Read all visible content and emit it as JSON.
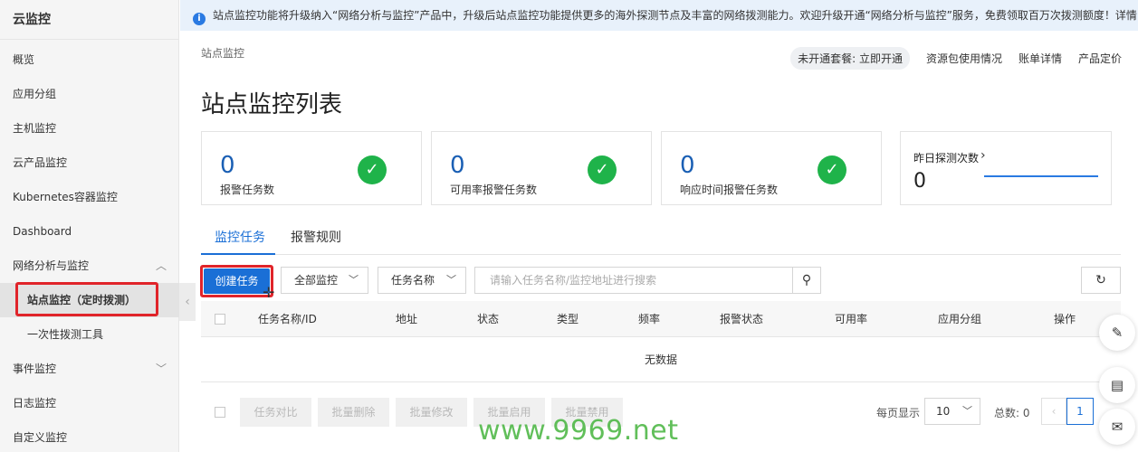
{
  "sidebar": {
    "title": "云监控",
    "items": [
      {
        "label": "概览"
      },
      {
        "label": "应用分组"
      },
      {
        "label": "主机监控"
      },
      {
        "label": "云产品监控"
      },
      {
        "label": "Kubernetes容器监控"
      },
      {
        "label": "Dashboard"
      },
      {
        "label": "网络分析与监控",
        "expanded": true
      },
      {
        "label": "站点监控（定时拨测）",
        "active": true
      },
      {
        "label": "一次性拨测工具"
      },
      {
        "label": "事件监控"
      },
      {
        "label": "日志监控"
      },
      {
        "label": "自定义监控"
      }
    ]
  },
  "notice": {
    "text": "站点监控功能将升级纳入“网络分析与监控”产品中，升级后站点监控功能提供更多的海外探测节点及丰富的网络拨测能力。欢迎升级开通“网络分析与监控”服务，免费领取百万次拨测额度！详情"
  },
  "breadcrumb": "站点监控",
  "top_links": {
    "package": "未开通套餐: 立即开通",
    "usage": "资源包使用情况",
    "bill": "账单详情",
    "pricing": "产品定价"
  },
  "page_title": "站点监控列表",
  "cards": [
    {
      "value": "0",
      "label": "报警任务数"
    },
    {
      "value": "0",
      "label": "可用率报警任务数"
    },
    {
      "value": "0",
      "label": "响应时间报警任务数"
    }
  ],
  "probe_card": {
    "title": "昨日探测次数",
    "value": "0"
  },
  "tabs": [
    "监控任务",
    "报警规则"
  ],
  "toolbar": {
    "create": "创建任务",
    "monitor_filter": "全部监控",
    "field_filter": "任务名称",
    "search_placeholder": "请输入任务名称/监控地址进行搜索"
  },
  "table": {
    "columns": [
      "任务名称/ID",
      "地址",
      "状态",
      "类型",
      "频率",
      "报警状态",
      "可用率",
      "应用分组",
      "操作"
    ],
    "empty": "无数据"
  },
  "bulk_actions": [
    "任务对比",
    "批量删除",
    "批量修改",
    "批量启用",
    "批量禁用"
  ],
  "pagination": {
    "per_page_label": "每页显示",
    "per_page": "10",
    "total": "总数: 0",
    "current": "1"
  },
  "watermark": "www.9969.net",
  "colors": {
    "primary": "#1a6fd6",
    "success": "#1fb34a",
    "highlight": "#e0242a",
    "notice_bg": "#e8f1fb"
  }
}
